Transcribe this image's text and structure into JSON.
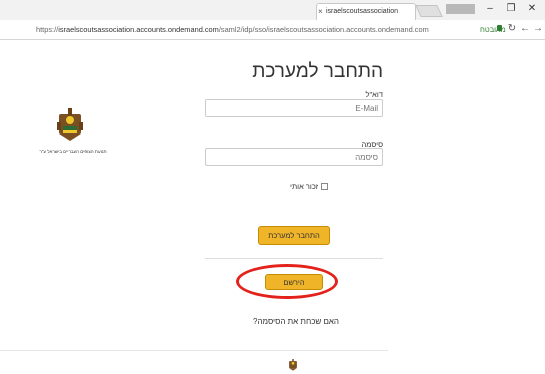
{
  "browser": {
    "tab_title": "israelscoutsassociation",
    "profile_badge": "",
    "url_prefix": "https://",
    "url_host": "israelscoutsassociation.accounts.ondemand.com",
    "url_path": "/saml2/idp/sso/israelscoutsassociation.accounts.ondemand.com",
    "secure_label": "מאובטח"
  },
  "org": {
    "name": "תנועת הצופים העבריים בישראל ע\"ר"
  },
  "form": {
    "title": "התחבר למערכת",
    "email_label": "דוא\"ל",
    "email_placeholder": "E-Mail",
    "password_label": "סיסמה",
    "password_placeholder": "סיסמה",
    "remember_label": "זכור אותי",
    "login_button": "התחבר למערכת",
    "register_button": "הירשם",
    "forgot_link": "האם שכחת את הסיסמה?"
  },
  "colors": {
    "button_fill": "#f0b429",
    "highlight_circle": "#e3231b"
  }
}
